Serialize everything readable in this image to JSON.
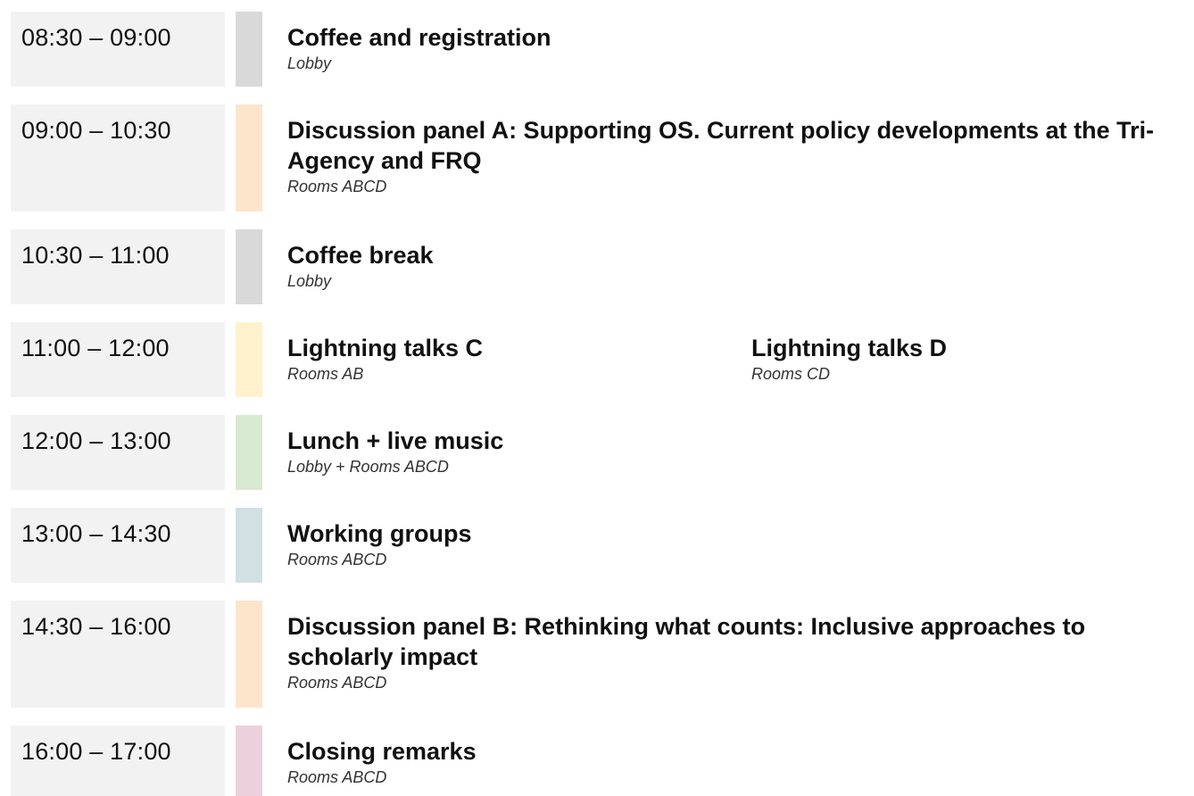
{
  "colors": {
    "time_bg": "#f2f2f2",
    "break": "#d9d9d9",
    "panel": "#fde5cc",
    "lightning": "#fff2cc",
    "lunch": "#d9ead3",
    "working": "#d0e0e3",
    "closing": "#ead1dc"
  },
  "rows": [
    {
      "time": "08:30 – 09:00",
      "color": "#d9d9d9",
      "sessions": [
        {
          "title": "Coffee and registration",
          "location": "Lobby"
        }
      ]
    },
    {
      "time": "09:00 – 10:30",
      "color": "#fde5cc",
      "sessions": [
        {
          "title": "Discussion panel A: Supporting OS. Current policy developments at the Tri-Agency and FRQ",
          "location": "Rooms ABCD"
        }
      ]
    },
    {
      "time": "10:30 – 11:00",
      "color": "#d9d9d9",
      "sessions": [
        {
          "title": "Coffee break",
          "location": "Lobby"
        }
      ]
    },
    {
      "time": "11:00 – 12:00",
      "color": "#fff2cc",
      "sessions": [
        {
          "title": "Lightning talks C",
          "location": "Rooms AB"
        },
        {
          "title": "Lightning talks D",
          "location": "Rooms CD"
        }
      ]
    },
    {
      "time": "12:00 – 13:00",
      "color": "#d9ead3",
      "sessions": [
        {
          "title": "Lunch + live music",
          "location": "Lobby + Rooms ABCD"
        }
      ]
    },
    {
      "time": "13:00 – 14:30",
      "color": "#d0e0e3",
      "sessions": [
        {
          "title": "Working groups",
          "location": "Rooms ABCD"
        }
      ]
    },
    {
      "time": "14:30 – 16:00",
      "color": "#fde5cc",
      "sessions": [
        {
          "title": "Discussion panel B: Rethinking what counts: Inclusive approaches to scholarly impact",
          "location": "Rooms ABCD"
        }
      ]
    },
    {
      "time": "16:00 – 17:00",
      "color": "#ead1dc",
      "sessions": [
        {
          "title": "Closing remarks",
          "location": "Rooms ABCD"
        }
      ]
    }
  ]
}
